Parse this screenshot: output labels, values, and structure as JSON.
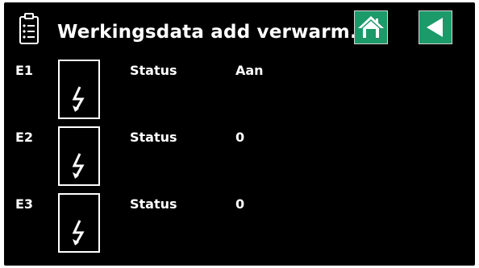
{
  "header": {
    "title": "Werkingsdata add verwarm.",
    "icon": "clipboard-list-icon",
    "home_icon": "home-icon",
    "back_icon": "back-arrow-icon",
    "button_color": "#1c9a6a"
  },
  "rows": [
    {
      "label": "E1",
      "icon": "lightning-bolt-icon",
      "status_label": "Status",
      "status_value": "Aan"
    },
    {
      "label": "E2",
      "icon": "lightning-bolt-icon",
      "status_label": "Status",
      "status_value": "0"
    },
    {
      "label": "E3",
      "icon": "lightning-bolt-icon",
      "status_label": "Status",
      "status_value": "0"
    }
  ]
}
